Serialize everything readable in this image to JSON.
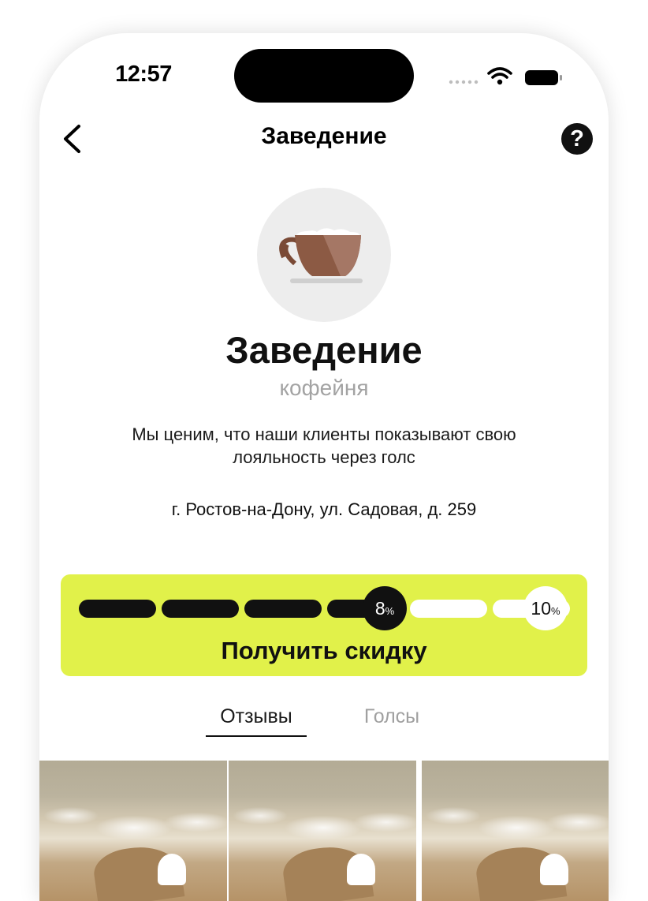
{
  "status_bar": {
    "time": "12:57"
  },
  "nav": {
    "title": "Заведение",
    "help_icon": "?"
  },
  "venue": {
    "name": "Заведение",
    "type": "кофейня",
    "description": "Мы ценим, что наши клиенты показывают свою лояльность через голс",
    "address": "г. Ростов-на-Дону, ул. Садовая, д. 259"
  },
  "discount": {
    "label": "Получить скидку",
    "current_value": "8",
    "target_value": "10",
    "percent_sign": "%",
    "segments_total": 6,
    "segments_filled": 4,
    "accent_color": "#e1f14a"
  },
  "tabs": [
    {
      "label": "Отзывы",
      "active": true
    },
    {
      "label": "Голсы",
      "active": false
    }
  ]
}
